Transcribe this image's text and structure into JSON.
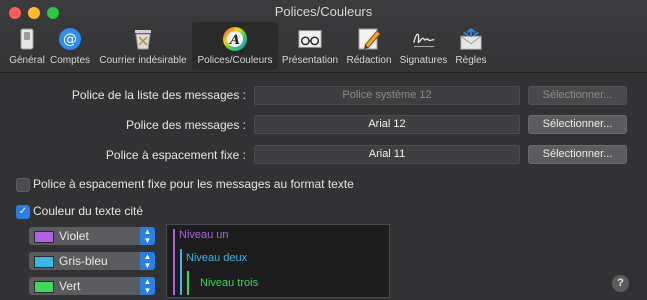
{
  "window": {
    "title": "Polices/Couleurs"
  },
  "toolbar": {
    "items": [
      {
        "label": "Général",
        "icon": "switch-icon"
      },
      {
        "label": "Comptes",
        "icon": "at-icon"
      },
      {
        "label": "Courrier indésirable",
        "icon": "trash-junk-icon"
      },
      {
        "label": "Polices/Couleurs",
        "icon": "fonts-colors-icon",
        "active": true
      },
      {
        "label": "Présentation",
        "icon": "glasses-icon"
      },
      {
        "label": "Rédaction",
        "icon": "pencil-icon"
      },
      {
        "label": "Signatures",
        "icon": "signature-icon"
      },
      {
        "label": "Règles",
        "icon": "rules-envelope-icon"
      }
    ]
  },
  "fonts": {
    "list_label": "Police de la liste des messages :",
    "list_value": "Police système 12",
    "list_button": "Sélectionner...",
    "message_label": "Police des messages :",
    "message_value": "Arial 12",
    "message_button": "Sélectionner...",
    "fixed_label": "Police à espacement fixe :",
    "fixed_value": "Arial 11",
    "fixed_button": "Sélectionner..."
  },
  "options": {
    "fixed_plaintext_label": "Police à espacement fixe pour les messages au format texte",
    "quoted_color_label": "Couleur du texte cité"
  },
  "quote_colors": [
    {
      "label": "Violet",
      "color": "#b25ee6"
    },
    {
      "label": "Gris-bleu",
      "color": "#38b6e6"
    },
    {
      "label": "Vert",
      "color": "#3fd85a"
    }
  ],
  "preview": {
    "level1": "Niveau un",
    "level2": "Niveau deux",
    "level3": "Niveau trois"
  },
  "help": "?"
}
